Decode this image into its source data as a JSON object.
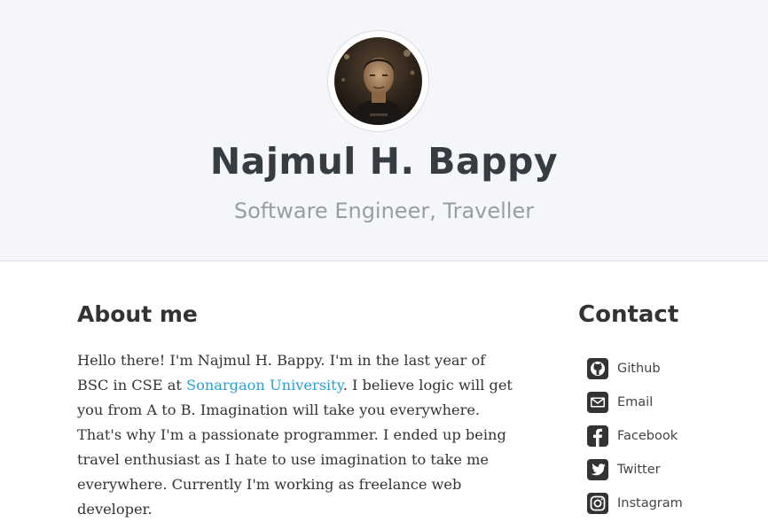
{
  "hero": {
    "name": "Najmul H. Bappy",
    "subtitle": "Software Engineer, Traveller"
  },
  "about": {
    "title": "About me",
    "text_before_link": "Hello there! I'm Najmul H. Bappy. I'm in the last year of BSC in CSE at ",
    "link_text": "Sonargaon University",
    "text_after_link": ". I believe logic will get you from A to B. Imagination will take you everywhere. That's why I'm a passionate programmer. I ended up being travel enthusiast as I hate to use imagination to take me everywhere. Currently I'm working as freelance web developer."
  },
  "contact": {
    "title": "Contact",
    "items": [
      {
        "label": "Github",
        "icon": "github-icon"
      },
      {
        "label": "Email",
        "icon": "email-icon"
      },
      {
        "label": "Facebook",
        "icon": "facebook-icon"
      },
      {
        "label": "Twitter",
        "icon": "twitter-icon"
      },
      {
        "label": "Instagram",
        "icon": "instagram-icon"
      }
    ]
  },
  "colors": {
    "hero_bg": "#f4f6f9",
    "link": "#2a9fd6",
    "heading": "#353d42",
    "subtitle": "#9a9da1",
    "icon": "#333333"
  }
}
